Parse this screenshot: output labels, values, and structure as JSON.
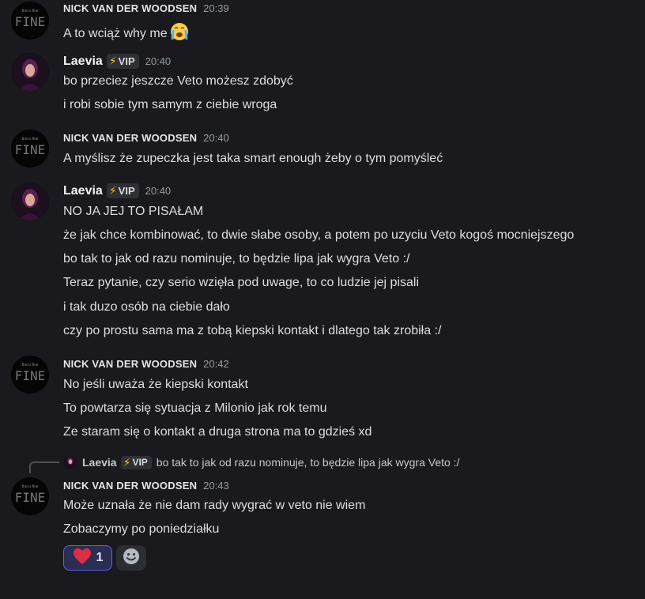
{
  "colors": {
    "background": "#1a1a1e",
    "vip_bolt": "#f7c325",
    "reaction_border": "#5865f2"
  },
  "users": {
    "nick": {
      "name": "NICK VAN DER WOODSEN",
      "avatar_text": "FINE",
      "avatar_small": "this is fine"
    },
    "laevia": {
      "name": "Laevia",
      "badge": "VIP"
    }
  },
  "messages": [
    {
      "author": "nick",
      "time": "20:39",
      "lines": [
        "A to wciąż why me"
      ],
      "emoji": "crying-face"
    },
    {
      "author": "laevia",
      "time": "20:40",
      "lines": [
        "bo przeciez jeszcze Veto możesz zdobyć",
        "i robi sobie tym samym z ciebie wroga"
      ]
    },
    {
      "author": "nick",
      "time": "20:40",
      "lines": [
        "A myślisz że zupeczka jest taka smart enough żeby o tym pomyśleć"
      ]
    },
    {
      "author": "laevia",
      "time": "20:40",
      "lines": [
        "NO JA JEJ TO PISAŁAM",
        "że jak chce kombinować, to dwie słabe osoby, a potem po uzyciu Veto kogoś mocniejszego",
        "bo tak to jak od razu nominuje, to będzie lipa jak wygra Veto :/",
        "Teraz pytanie, czy serio wzięła pod uwage, to co ludzie jej pisali",
        "i tak duzo osób na ciebie dało",
        "czy po prostu sama ma z tobą kiepski kontakt i dlatego tak zrobiła :/"
      ]
    },
    {
      "author": "nick",
      "time": "20:42",
      "lines": [
        "No jeśli uważa że kiepski kontakt",
        "To powtarza się sytuacja z Milonio jak rok temu",
        "Ze staram się o kontakt a druga strona ma to gdzieś xd"
      ]
    },
    {
      "author": "nick",
      "time": "20:43",
      "reply": {
        "author": "Laevia",
        "badge": "VIP",
        "text": "bo tak to jak od razu nominuje, to będzie lipa jak wygra Veto :/"
      },
      "lines": [
        "Może uznała że nie dam rady wygrać w veto nie wiem",
        "Zobaczymy po poniedziałku"
      ],
      "reactions": [
        {
          "emoji": "heart",
          "count": "1"
        }
      ]
    }
  ]
}
